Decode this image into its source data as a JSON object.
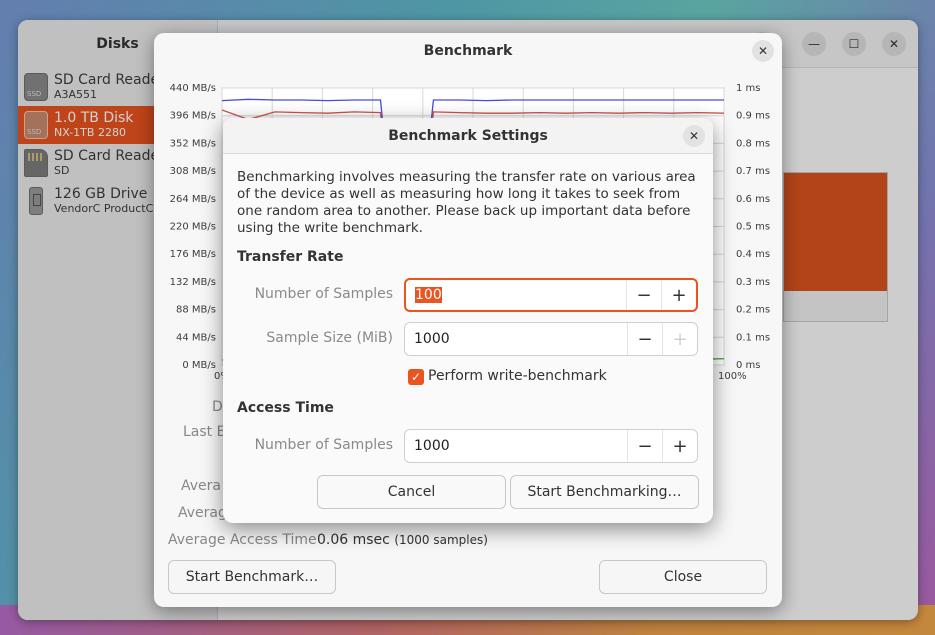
{
  "main_window": {
    "sidebar_title": "Disks",
    "title": "1.0 TB Disk",
    "disks": [
      {
        "name": "SD Card Reader",
        "sub": "A3A551",
        "icon": "ssd-icon",
        "badge": "SSD",
        "selected": false
      },
      {
        "name": "1.0 TB Disk",
        "sub": "NX-1TB 2280",
        "icon": "ssd-icon",
        "badge": "SSD",
        "selected": true
      },
      {
        "name": "SD Card Reader",
        "sub": "SD",
        "icon": "sd-card-icon",
        "badge": "",
        "selected": false
      },
      {
        "name": "126 GB Drive",
        "sub": "VendorC ProductC",
        "icon": "usb-drive-icon",
        "badge": "",
        "selected": false
      }
    ],
    "window_controls": {
      "minimize": "—",
      "maximize": "☐",
      "close": "✕"
    },
    "accent": "#e95420"
  },
  "benchmark": {
    "title": "Benchmark",
    "close_icon": "✕",
    "chart_data": {
      "type": "line",
      "y_left_ticks": [
        "440 MB/s",
        "396 MB/s",
        "352 MB/s",
        "308 MB/s",
        "264 MB/s",
        "220 MB/s",
        "176 MB/s",
        "132 MB/s",
        "88 MB/s",
        "44 MB/s",
        "0 MB/s"
      ],
      "y_right_ticks": [
        "1 ms",
        "0.9 ms",
        "0.8 ms",
        "0.7 ms",
        "0.6 ms",
        "0.5 ms",
        "0.4 ms",
        "0.3 ms",
        "0.2 ms",
        "0.1 ms",
        "0 ms"
      ],
      "x_ticks": [
        "0%",
        "100%"
      ],
      "ylim_left": [
        0,
        440
      ],
      "ylim_right": [
        0,
        1
      ],
      "series": [
        {
          "color": "#4a4adf",
          "values": [
            420,
            422,
            421,
            421,
            420,
            421,
            421,
            0,
            421,
            421,
            420,
            421,
            421,
            421,
            421,
            421,
            421,
            421,
            421,
            421
          ]
        },
        {
          "color": "#d05050",
          "values": [
            405,
            390,
            402,
            401,
            400,
            402,
            401,
            0,
            402,
            401,
            400,
            400,
            401,
            400,
            401,
            400,
            401,
            400,
            401,
            400
          ]
        },
        {
          "color": "#50a050",
          "values": [
            8,
            10,
            9,
            11,
            8,
            10,
            9,
            10,
            8,
            10,
            9,
            10,
            11,
            9,
            10,
            9,
            8,
            10,
            9,
            10
          ]
        }
      ]
    },
    "stats": {
      "d_label": "D",
      "last_label": "Last B",
      "avg_label_1": "Avera",
      "avg_label_2": "Averag",
      "avg_access_label": "Average Access Time",
      "avg_access_value": "0.06 msec",
      "avg_access_samples": "(1000 samples)"
    },
    "start_button": "Start Benchmark…",
    "close_button": "Close"
  },
  "settings": {
    "title": "Benchmark Settings",
    "close_icon": "✕",
    "description": "Benchmarking involves measuring the transfer rate on various area of the device as well as measuring how long it takes to seek from one random area to another. Please back up important data before using the write benchmark.",
    "transfer_rate_title": "Transfer Rate",
    "num_samples_label": "Number of Samples",
    "num_samples_value": "100",
    "sample_size_label": "Sample Size (MiB)",
    "sample_size_value": "1000",
    "write_benchmark_label": "Perform write-benchmark",
    "write_benchmark_checked": true,
    "access_time_title": "Access Time",
    "access_samples_label": "Number of Samples",
    "access_samples_value": "1000",
    "minus": "−",
    "plus": "+",
    "cancel_button": "Cancel",
    "start_button": "Start Benchmarking…"
  }
}
